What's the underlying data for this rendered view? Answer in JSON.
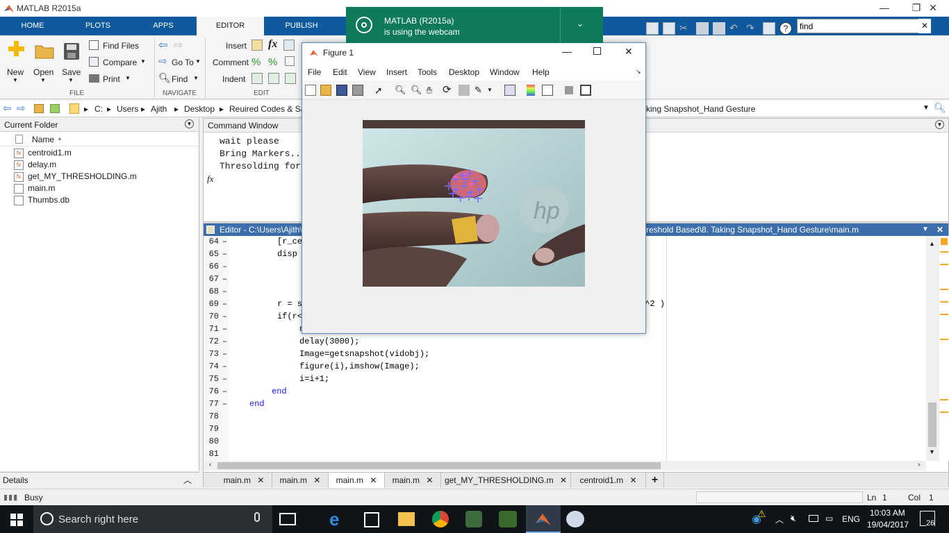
{
  "window": {
    "title": "MATLAB R2015a"
  },
  "ribbon_tabs": [
    "HOME",
    "PLOTS",
    "APPS",
    "EDITOR",
    "PUBLISH"
  ],
  "active_tab": "EDITOR",
  "search": {
    "value": "find"
  },
  "ribbon": {
    "new": "New",
    "open": "Open",
    "save": "Save",
    "find_files": "Find Files",
    "compare": "Compare",
    "print": "Print",
    "go_to": "Go To",
    "find": "Find",
    "insert": "Insert",
    "comment": "Comment",
    "indent": "Indent",
    "groups": {
      "file": "FILE",
      "navigate": "NAVIGATE",
      "edit": "EDIT"
    }
  },
  "path": {
    "drive": "C:",
    "segments": [
      "Users",
      "Ajith",
      "Desktop",
      "Reuired Codes & Sa"
    ],
    "tail": "king Snapshot_Hand Gesture"
  },
  "current_folder": {
    "title": "Current Folder",
    "column": "Name",
    "files": [
      "centroid1.m",
      "delay.m",
      "get_MY_THRESHOLDING.m",
      "main.m",
      "Thumbs.db"
    ]
  },
  "details": {
    "label": "Details"
  },
  "command_window": {
    "title": "Command Window",
    "lines": [
      "wait please",
      "Bring Markers..",
      "Thresolding for"
    ],
    "fx": "fx"
  },
  "editor": {
    "title_left": "Editor - C:\\Users\\Ajith\\",
    "title_right": "reshold Based\\8. Taking Snapshot_Hand Gesture\\main.m",
    "line_numbers": [
      "64",
      "65",
      "66",
      "67",
      "68",
      "69",
      "70",
      "71",
      "72",
      "73",
      "74",
      "75",
      "76",
      "77",
      "78",
      "79",
      "80",
      "81"
    ],
    "code": [
      "[r_ce",
      "disp",
      "",
      "",
      "",
      "r = s",
      "if(r<",
      "n",
      "delay(3000);",
      "Image=getsnapshot(vidobj);",
      "figure(i),imshow(Image);",
      "i=i+1;",
      "end",
      "end",
      "",
      "",
      "",
      ""
    ],
    "code_tail_69": ".^2 )",
    "tabs": [
      "main.m",
      "main.m",
      "main.m",
      "main.m",
      "get_MY_THRESHOLDING.m",
      "centroid1.m"
    ],
    "active_tab_index": 2
  },
  "status": {
    "text": "Busy",
    "ln_label": "Ln",
    "ln": "1",
    "col_label": "Col",
    "col": "1"
  },
  "figure": {
    "title": "Figure 1",
    "menu": [
      "File",
      "Edit",
      "View",
      "Insert",
      "Tools",
      "Desktop",
      "Window",
      "Help"
    ]
  },
  "notification": {
    "title": "MATLAB (R2015a)",
    "body": "is using the webcam"
  },
  "taskbar": {
    "search_placeholder": "Search right here",
    "lang": "ENG",
    "time": "10:03 AM",
    "date": "19/04/2017",
    "notif_count": "26"
  },
  "colors": {
    "ribbon_blue": "#0e5a9c",
    "editor_head": "#3c6eab",
    "notification": "#0f7a5a",
    "keyword": "#1a1aff"
  }
}
